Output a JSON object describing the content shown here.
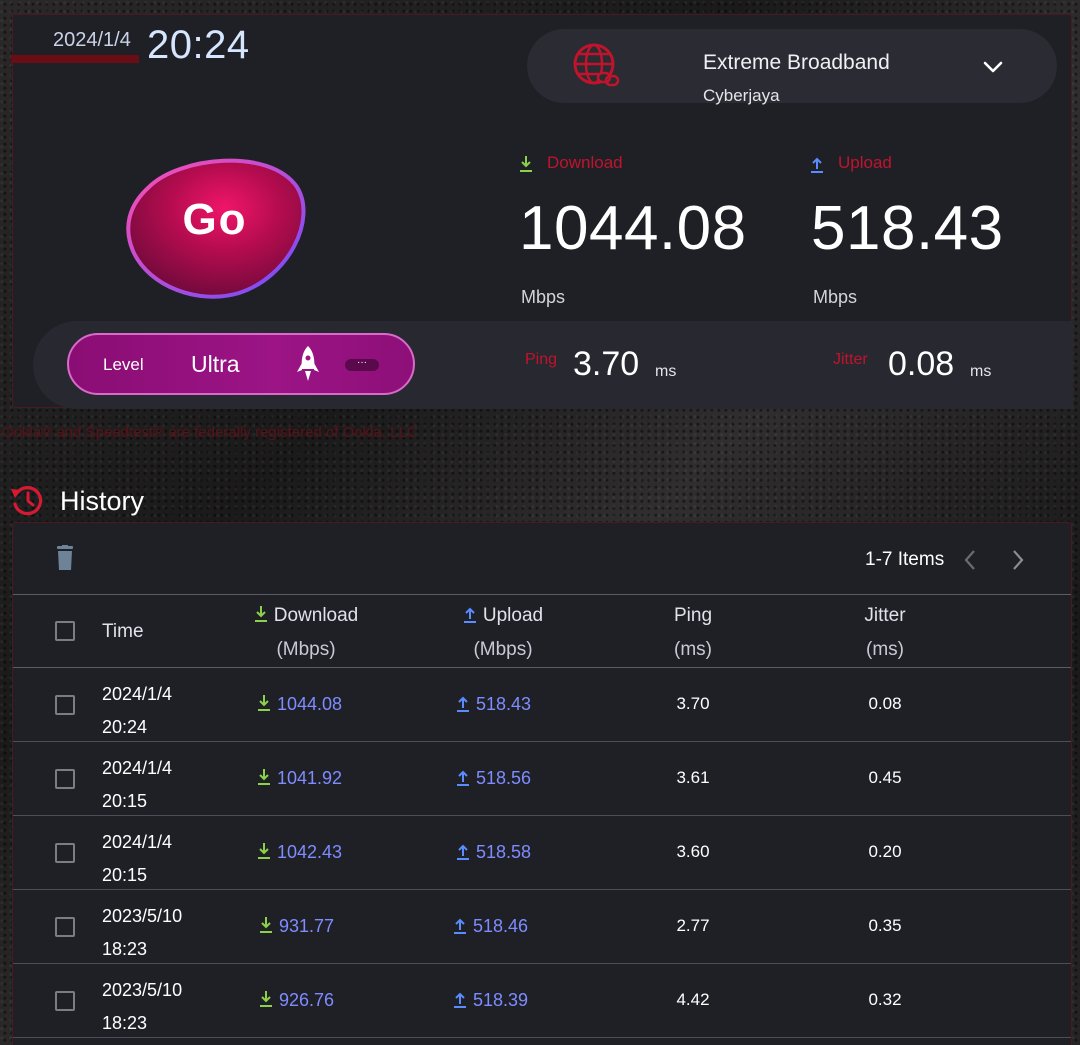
{
  "clock": {
    "date": "2024/1/4",
    "time": "20:24"
  },
  "server": {
    "name": "Extreme Broadband",
    "city": "Cyberjaya"
  },
  "go_button": {
    "label": "Go"
  },
  "level": {
    "label": "Level",
    "value": "Ultra",
    "more": "···"
  },
  "download": {
    "label": "Download",
    "value": "1044.08",
    "unit": "Mbps"
  },
  "upload": {
    "label": "Upload",
    "value": "518.43",
    "unit": "Mbps"
  },
  "ping": {
    "label": "Ping",
    "value": "3.70",
    "unit": "ms"
  },
  "jitter": {
    "label": "Jitter",
    "value": "0.08",
    "unit": "ms"
  },
  "disclaimer": "Ookla® and Speedtest® are federally registered of Ookla, LLC",
  "history": {
    "title": "History",
    "items_count": "1-7 Items",
    "columns": {
      "time": "Time",
      "download": "Download",
      "download_unit": "(Mbps)",
      "upload": "Upload",
      "upload_unit": "(Mbps)",
      "ping": "Ping",
      "ping_unit": "(ms)",
      "jitter": "Jitter",
      "jitter_unit": "(ms)"
    },
    "rows": [
      {
        "date": "2024/1/4",
        "time": "20:24",
        "download": "1044.08",
        "upload": "518.43",
        "ping": "3.70",
        "jitter": "0.08"
      },
      {
        "date": "2024/1/4",
        "time": "20:15",
        "download": "1041.92",
        "upload": "518.56",
        "ping": "3.61",
        "jitter": "0.45"
      },
      {
        "date": "2024/1/4",
        "time": "20:15",
        "download": "1042.43",
        "upload": "518.58",
        "ping": "3.60",
        "jitter": "0.20"
      },
      {
        "date": "2023/5/10",
        "time": "18:23",
        "download": "931.77",
        "upload": "518.46",
        "ping": "2.77",
        "jitter": "0.35"
      },
      {
        "date": "2023/5/10",
        "time": "18:23",
        "download": "926.76",
        "upload": "518.39",
        "ping": "4.42",
        "jitter": "0.32"
      }
    ]
  },
  "colors": {
    "accent_red": "#c0142c",
    "value_blue": "#7d8cff",
    "download_green": "#8bd14a",
    "upload_blue": "#5a8cff",
    "level_magenta": "#9c1486"
  }
}
